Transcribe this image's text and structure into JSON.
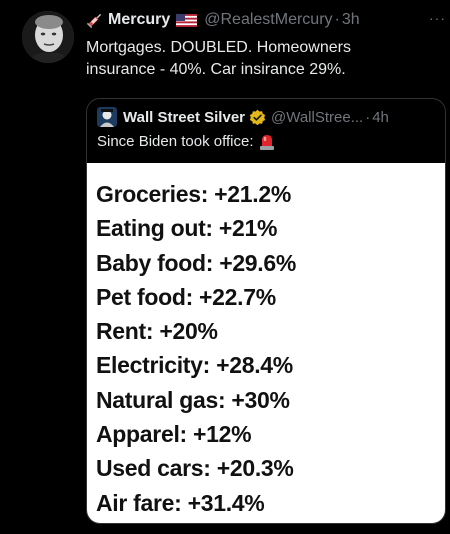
{
  "tweet": {
    "display_name": "Mercury",
    "handle": "@RealestMercury",
    "separator": "·",
    "time": "3h",
    "more_icon": "more-icon",
    "text_line1": "Mortgages. DOUBLED. Homeowners",
    "text_line2": "insurance - 40%. Car insirance 29%."
  },
  "quote": {
    "display_name": "Wall Street Silver",
    "handle": "@WallStree...",
    "separator": "·",
    "time": "4h",
    "text": "Since Biden took office:",
    "stats": [
      "Groceries: +21.2%",
      "Eating out: +21%",
      "Baby food: +29.6%",
      "Pet food: +22.7%",
      "Rent: +20%",
      "Electricity: +28.4%",
      "Natural gas: +30%",
      "Apparel: +12%",
      "Used cars: +20.3%",
      "Air fare: +31.4%"
    ]
  },
  "colors": {
    "background": "#000000",
    "text": "#e7e9ea",
    "muted": "#71767b",
    "border": "#2f3336",
    "verified_gold": "#e2b719",
    "image_background": "#ffffff"
  }
}
